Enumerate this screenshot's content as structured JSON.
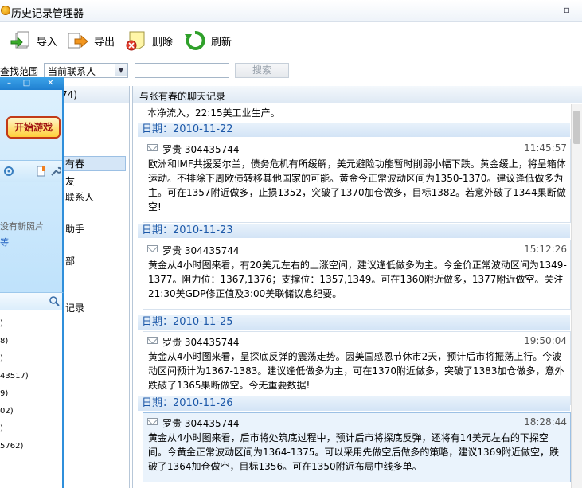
{
  "window": {
    "title": "历史记录管理器"
  },
  "toolbar": {
    "import": "导入",
    "export": "导出",
    "delete": "删除",
    "refresh": "刷新"
  },
  "search": {
    "label": "查找范围",
    "scope": "当前联系人",
    "value": "",
    "button": "搜索"
  },
  "left": {
    "header": "74)",
    "items": [
      "有春",
      "友",
      "联系人",
      "助手",
      "部",
      "记录"
    ],
    "overlay": {
      "game_label": "开始游戏",
      "no_photo": "没有新照片",
      "link": "等",
      "numbers": [
        ")",
        "8)",
        ")",
        "43517)",
        "9)",
        "02)",
        ")",
        "5762)"
      ]
    }
  },
  "right": {
    "header": "与张有春的聊天记录",
    "partial_top": "本净流入，22:15美工业生产。",
    "blocks": [
      {
        "date": "日期：2010-11-22",
        "sender": "罗贵 304435744",
        "time": "11:45:57",
        "text": "欧洲和IMF共援爱尔兰，债务危机有所缓解，美元避险功能暂时削弱小幅下跌。黄金缓上，将呈箱体运动。不排除下周欧债转移其他国家的可能。黄金今正常波动区间为1350-1370。建议逢低做多为主。可在1357附近做多，止损1352，突破了1370加仓做多，目标1382。若意外破了1344果断做空!"
      },
      {
        "date": "日期：2010-11-23",
        "sender": "罗贵 304435744",
        "time": "15:12:26",
        "text": "黄金从4小时图来看，有20美元左右的上涨空间，建议逢低做多为主。今金价正常波动区间为1349-1377。阻力位：1367,1376；支撑位：1357,1349。可在1360附近做多，1377附近做空。关注21:30美GDP修正值及3:00美联储议息纪要。"
      },
      {
        "date": "日期：2010-11-25",
        "sender": "罗贵 304435744",
        "time": "19:50:04",
        "text": "黄金从4小时图来看，呈探底反弹的震荡走势。因美国感恩节休市2天，预计后市将振荡上行。今波动区间预计为1367-1383。建议逢低做多为主，可在1370附近做多，突破了1383加仓做多，意外跌破了1365果断做空。今无重要数据!"
      },
      {
        "date": "日期：2010-11-26",
        "sender": "罗贵 304435744",
        "time": "18:28:44",
        "text": "黄金从4小时图来看，后市将处筑底过程中，预计后市将探底反弹，还将有14美元左右的下探空间。今黄金正常波动区间为1364-1375。可以采用先做空后做多的策略，建议1369附近做空，跌破了1364加仓做空，目标1356。可在1350附近布局中线多单。"
      }
    ]
  }
}
